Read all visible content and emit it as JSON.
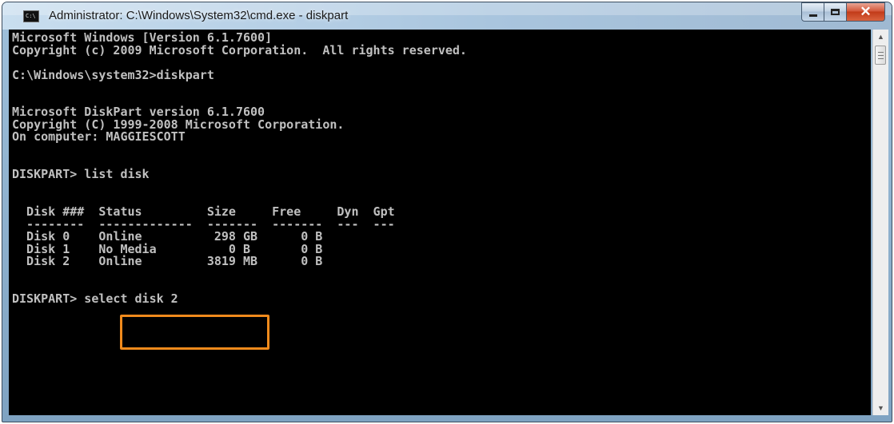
{
  "window": {
    "title": "Administrator: C:\\Windows\\System32\\cmd.exe - diskpart",
    "icon_label": "C:\\",
    "icon": "cmd-app-icon",
    "buttons": {
      "minimize": "minimize-icon",
      "maximize": "maximize-icon",
      "close": "✕"
    }
  },
  "console": {
    "lines": [
      "Microsoft Windows [Version 6.1.7600]",
      "Copyright (c) 2009 Microsoft Corporation.  All rights reserved.",
      "C:\\Windows\\system32>diskpart",
      "Microsoft DiskPart version 6.1.7600",
      "Copyright (C) 1999-2008 Microsoft Corporation.",
      "On computer: MAGGIESCOTT",
      "DISKPART> list disk",
      "  Disk ###  Status         Size     Free     Dyn  Gpt",
      "  --------  -------------  -------  -------  ---  ---",
      "  Disk 0    Online          298 GB      0 B",
      "  Disk 1    No Media          0 B       0 B",
      "  Disk 2    Online         3819 MB      0 B",
      "DISKPART> select disk 2"
    ]
  },
  "highlight": {
    "color": "#f08a1c",
    "text": "select disk 2"
  },
  "scrollbar": {
    "up_icon": "▲",
    "down_icon": "▼"
  }
}
